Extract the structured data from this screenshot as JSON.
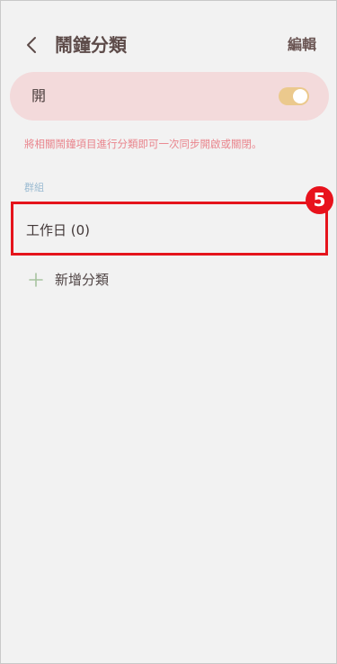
{
  "header": {
    "title": "鬧鐘分類",
    "edit_label": "編輯"
  },
  "master_switch": {
    "label": "開",
    "state": "on"
  },
  "description": "將相關鬧鐘項目進行分類即可一次同步開啟或關閉。",
  "groups": {
    "section_label": "群組",
    "items": [
      {
        "label": "工作日 (0)"
      }
    ],
    "add_label": "新增分類"
  },
  "annotation": {
    "step_number": "5"
  },
  "colors": {
    "background": "#f2f2f2",
    "switch_card": "#f3dadb",
    "toggle_on": "#ebc98d",
    "description_text": "#e9848c",
    "section_label": "#9cbcd2",
    "highlight": "#e5141c",
    "add_icon": "#a7c3a0"
  }
}
